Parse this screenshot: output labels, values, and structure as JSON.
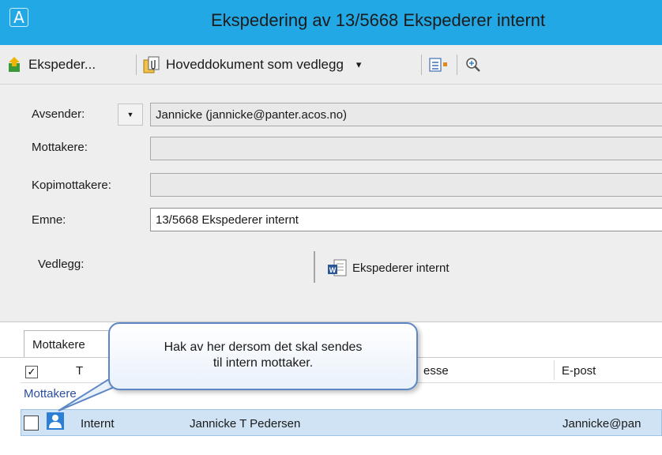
{
  "window": {
    "title": "Ekspedering av 13/5668 Ekspederer internt",
    "logo": "A"
  },
  "toolbar": {
    "send_label": "Ekspeder...",
    "main_doc_label": "Hoveddokument som vedlegg",
    "dropdown_arrow": "▾",
    "icons": [
      "send-icon",
      "attach-document-icon",
      "dropdown-arrow-icon",
      "list-options-icon",
      "zoom-icon"
    ]
  },
  "form": {
    "sender_label": "Avsender:",
    "sender_value": "Jannicke (jannicke@panter.acos.no)",
    "recipients_label": "Mottakere:",
    "recipients_value": "",
    "cc_label": "Kopimottakere:",
    "cc_value": "",
    "subject_label": "Emne:",
    "subject_value": "13/5668 Ekspederer internt",
    "attachments_label": "Vedlegg:",
    "attachment_name": "Ekspederer internt"
  },
  "tabs": [
    "Mottakere"
  ],
  "recipients_table": {
    "columns": [
      "T",
      "esse",
      "E-post"
    ],
    "group_label": "Mottakere",
    "rows": [
      {
        "type": "Internt",
        "name": "Jannicke T Pedersen",
        "email": "Jannicke@pan"
      }
    ]
  },
  "callout": {
    "line1": "Hak av her dersom det skal sendes",
    "line2": "til intern mottaker."
  },
  "colors": {
    "titlebar": "#23a8e6",
    "row_highlight": "#cfe3f4",
    "callout_border": "#5c87c4"
  }
}
